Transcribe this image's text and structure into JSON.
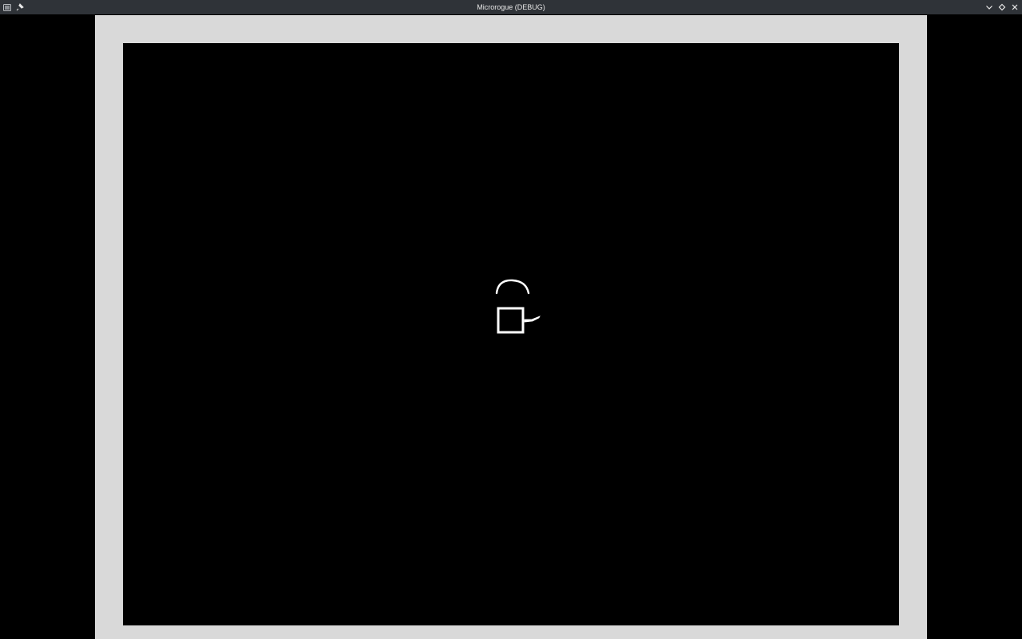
{
  "window": {
    "title": "Microrogue (DEBUG)",
    "icons": {
      "app": "app-icon",
      "pin": "pin-icon",
      "minimize": "chevron-down-icon",
      "maximize": "diamond-icon",
      "close": "close-icon"
    },
    "colors": {
      "titlebar_bg": "#2f3338",
      "titlebar_text": "#e8e8e8"
    }
  },
  "game": {
    "colors": {
      "background": "#000000",
      "wall": "#d9d9d9",
      "sprite": "#ffffff"
    },
    "entities": [
      {
        "name": "player",
        "shape": "square-outline"
      },
      {
        "name": "sword",
        "shape": "blade"
      },
      {
        "name": "slash-arc",
        "shape": "arc"
      }
    ]
  }
}
